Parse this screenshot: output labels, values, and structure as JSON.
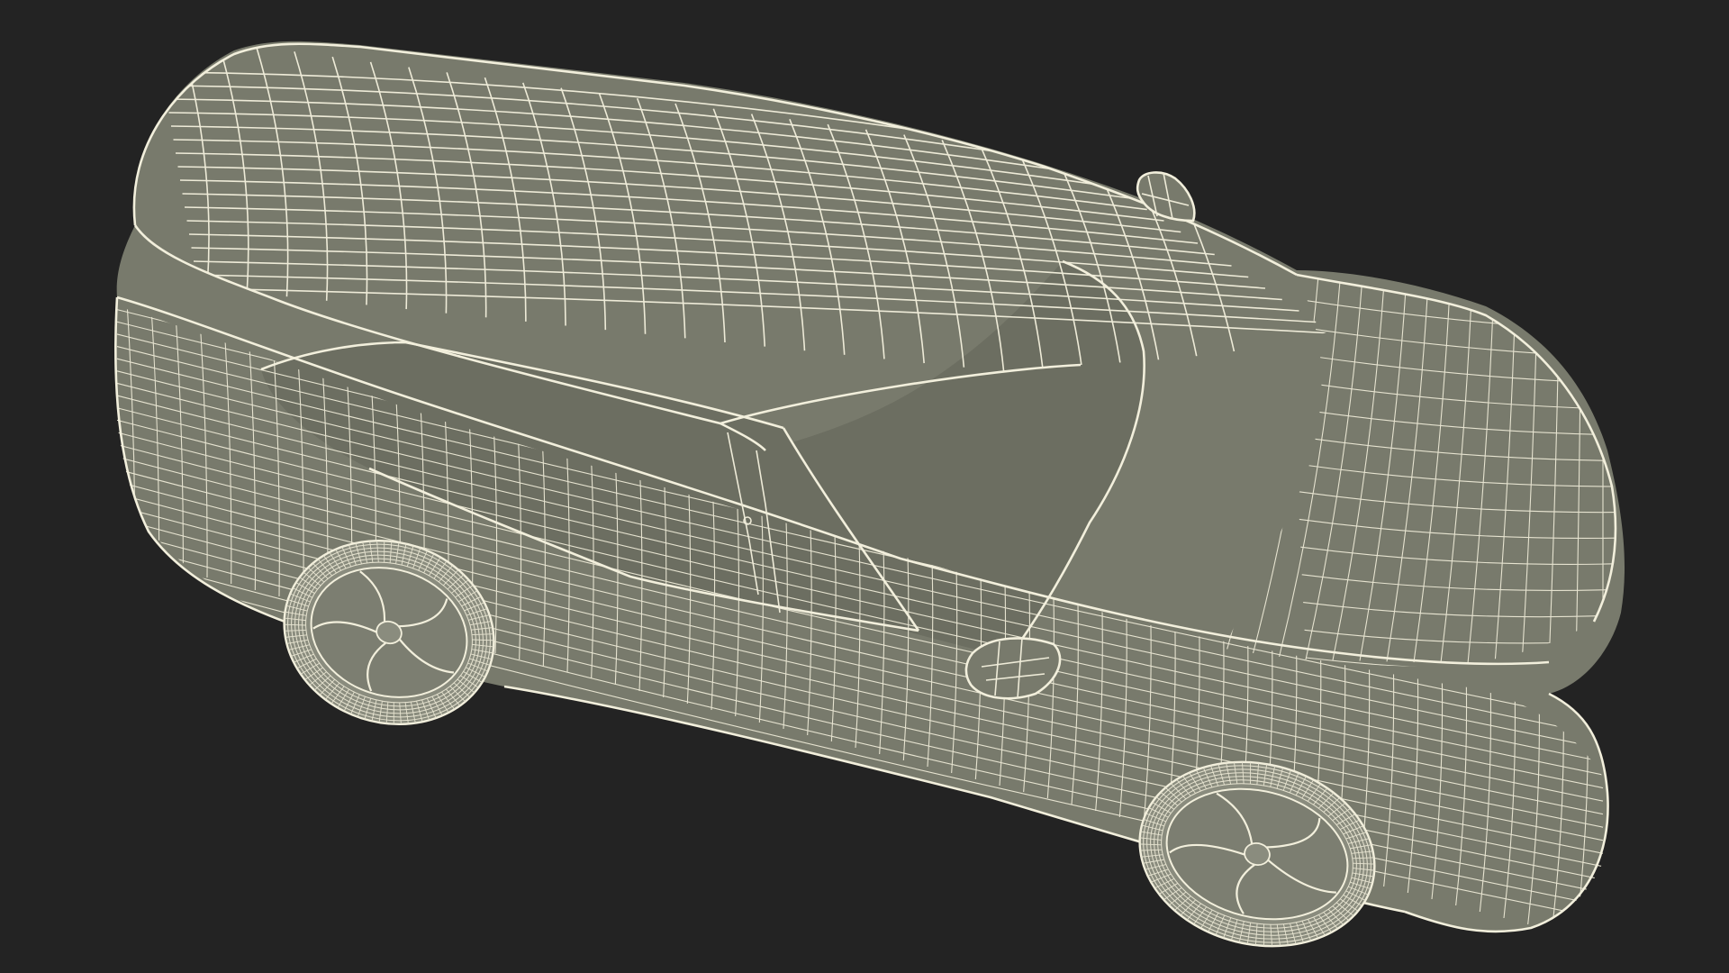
{
  "scene": {
    "background_color": "#232323",
    "mesh_fill_color": "#787a6c",
    "wire_color": "#eeebd8",
    "subject": "wireframe-car-model",
    "view": "top-three-quarter"
  }
}
